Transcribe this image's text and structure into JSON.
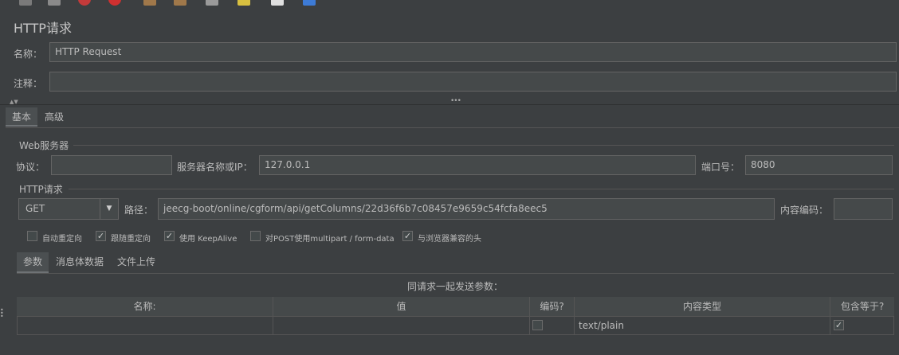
{
  "panel": {
    "title": "HTTP请求",
    "name_label": "名称：",
    "name_value": "HTTP Request",
    "comment_label": "注释：",
    "comment_value": ""
  },
  "main_tabs": {
    "basic": "基本",
    "advanced": "高级"
  },
  "web_server": {
    "legend": "Web服务器",
    "protocol_label": "协议：",
    "protocol_value": "",
    "server_label": "服务器名称或IP：",
    "server_value": "127.0.0.1",
    "port_label": "端口号：",
    "port_value": "8080"
  },
  "http_request": {
    "legend": "HTTP请求",
    "method": "GET",
    "path_label": "路径：",
    "path_value": "jeecg-boot/online/cgform/api/getColumns/22d36f6b7c08457e9659c54fcfa8eec5",
    "encoding_label": "内容编码：",
    "encoding_value": ""
  },
  "options": {
    "auto_redirect": {
      "label": "自动重定向",
      "checked": ""
    },
    "follow_redirect": {
      "label": "跟随重定向",
      "checked": "✓"
    },
    "keepalive": {
      "label": "使用 KeepAlive",
      "checked": "✓"
    },
    "multipart": {
      "label": "对POST使用multipart / form-data",
      "checked": ""
    },
    "browser_headers": {
      "label": "与浏览器兼容的头",
      "checked": "✓"
    }
  },
  "sub_tabs": {
    "params": "参数",
    "body": "消息体数据",
    "files": "文件上传"
  },
  "params_table": {
    "caption": "同请求一起发送参数：",
    "headers": [
      "名称:",
      "值",
      "编码?",
      "内容类型",
      "包含等于?"
    ],
    "row": {
      "name": "",
      "value": "",
      "encode": "",
      "content_type": "text/plain",
      "include_equals": "✓"
    }
  }
}
